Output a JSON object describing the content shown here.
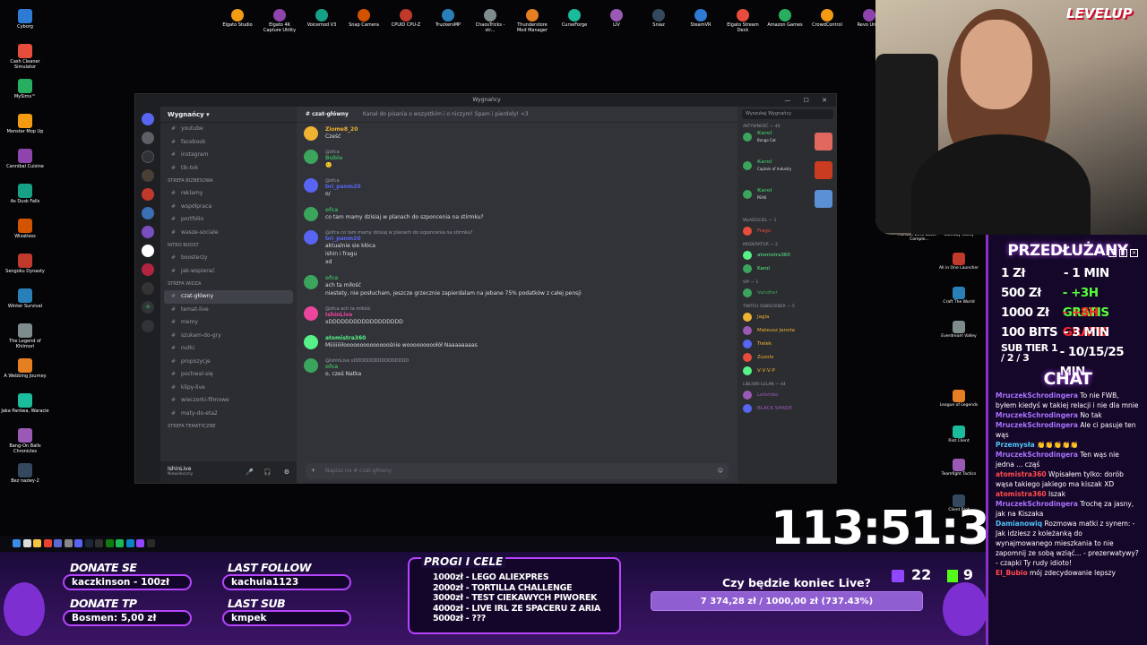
{
  "desktop_left": [
    "Cyborg",
    "Cash Cleaner Simulator",
    "MySims™",
    "Monster Mop Up",
    "Cannibal Cuisine",
    "As Dusk Falls",
    "Wizatless",
    "Sengoku Dynasty",
    "Winter Survival",
    "The Legend of Khiimori",
    "A Webbing Journey",
    "Jaka Parówa, Waracie",
    "Bang-On Balls Chronicles",
    "Bez nazwy-2"
  ],
  "desktop_top": [
    "Elgato Studio",
    "Elgato 4K Capture Utility",
    "Voicemod V3",
    "Snap Camera",
    "CPUID CPU-Z",
    "TruckersMP",
    "ChaosTricks - str...",
    "Thunderstore Mod Manager",
    "CurseForge",
    "LIV",
    "Sniaz",
    "SteamVR",
    "Elgato Stream Deck",
    "Amazon Games",
    "CrowdControl",
    "Revo Uni..."
  ],
  "desktop_right": [
    "Horizon Zero Dawn™ Comple...",
    "Standby Valley",
    "All in One Launcher",
    "Craft The World",
    "Everdream Valley",
    "League of Legends",
    "Riot Client",
    "Teamfight Tactics",
    "Client Riot"
  ],
  "discord": {
    "window_title": "Wygnańcy",
    "server_name": "Wygnańcy",
    "channels_top": [
      "youtube",
      "facebook",
      "instagram",
      "tik-tok"
    ],
    "category_1": "STREFA BIZNESOWA",
    "channels_biz": [
      "reklamy",
      "współpraca",
      "portfolio",
      "wasze-sociale"
    ],
    "category_2": "NITRO BOOST",
    "channels_nitro": [
      "boosterzy",
      "jak-wspierać"
    ],
    "category_3": "STREFA WIDZA",
    "channels_widza": [
      "czat-główny",
      "temat-live",
      "memy",
      "szukam-do-gry",
      "nutki",
      "propozycje",
      "pochwal-się",
      "klipy-live",
      "wieczorki-filmowe",
      "maty-do-eta2"
    ],
    "category_4": "STREFA TEMATYCZNE",
    "new_unread": "NOWE NIEPRZECZYTANE WIAD.",
    "user_name": "IshinLive",
    "user_status": "Niewidoczny",
    "chat_channel": "czat-główny",
    "chat_topic": "Kanał do pisania o wszystkim i o niczym! Spam i pierdoły! <3",
    "input_placeholder": "Napisz na #   czat-główny",
    "search_placeholder": "Wyszukaj Wygnańcy",
    "messages": [
      {
        "name": "Ziome8_20",
        "text": "Cześć",
        "color": "#f0b232"
      },
      {
        "name": "Bubio",
        "reply": "@ofca",
        "text": "🙂",
        "color": "#3ba55d"
      },
      {
        "name": "bri_panm20",
        "reply": "@ofca",
        "text": "o/",
        "color": "#5865f2"
      },
      {
        "name": "ofca",
        "text": "co tam mamy dzisiaj w planach do szponcenia na stirmku?",
        "color": "#3ba55d"
      },
      {
        "name": "bri_panm20",
        "reply": "@ofca co tam mamy dzisiaj w planach do szponcenia na stirmku?",
        "text": "aktualnie sie kłóca",
        "text2": "ishin i fragu",
        "text3": "xd",
        "color": "#5865f2"
      },
      {
        "name": "ofca",
        "text": "ach ta miłość",
        "text2": "niestety, nie posłucham, jeszcze grzecznie zapierdalam na jebane 75% podatków z całej pensji",
        "color": "#3ba55d"
      },
      {
        "name": "IshinLive",
        "reply": "@ofca ach ta miłość",
        "text": "xDDDDDDDDDDDDDDDDDD",
        "color": "#eb459e"
      },
      {
        "name": "atomistra360",
        "text": "Miiiiiiiiłoooooooooooooośnie wooooooooołół Naaaaaaaas",
        "color": "#57f287"
      },
      {
        "name": "ofca",
        "reply": "@IshinLive xDDDDDDDDDDDDDDDD",
        "text": "o, cześ Natka",
        "color": "#3ba55d"
      }
    ],
    "members_header": "Aktywność — 40",
    "members_groups": [
      {
        "label": "WŁAŚCICIEL — 1",
        "members": [
          "Fragu"
        ]
      },
      {
        "label": "Moderator — 2",
        "members": [
          "atomistra360",
          "Karol"
        ]
      },
      {
        "label": "VIP — 1",
        "members": [
          "Vandher"
        ]
      },
      {
        "label": "Twitch Subscriber — 5",
        "members": [
          "Jagla",
          "Mateusz Janota",
          "Trelek",
          "Zuzolo",
          "V·V·V·P"
        ]
      },
      {
        "label": "Liblioki lulan — 44",
        "members": [
          "Lelombo",
          "BLACK SHADE"
        ]
      }
    ],
    "activity_cards": [
      {
        "user": "Karol",
        "app": "Bongo Cat",
        "color": "#e0685e"
      },
      {
        "user": "Karol",
        "app": "Captain of Industry",
        "color": "#c93c1f"
      },
      {
        "user": "Karol",
        "app": "PEAK",
        "color": "#5b8fd6"
      }
    ]
  },
  "taskbar_icons": [
    "windows",
    "search",
    "explorer",
    "chrome",
    "store",
    "settings",
    "discord",
    "steam",
    "obs",
    "xbox",
    "spotify",
    "edge",
    "twitch",
    "epic"
  ],
  "stream": {
    "cam_logo": "LEVELUP",
    "panel_title": "PRZEDŁUŻANY",
    "prices": [
      {
        "k": "1 Zł",
        "v": "- 1 MIN",
        "accent": ""
      },
      {
        "k": "500 Zł",
        "v": "- +3H GRATIS",
        "accent": "green"
      },
      {
        "k": "1000 Zł",
        "v": "- +8H GRATIS",
        "accent": "red"
      },
      {
        "k": "100 BITS",
        "v": "- 3 MIN",
        "accent": ""
      },
      {
        "k": "SUB TIER 1 / 2 / 3",
        "v": "- 10/15/25 MIN",
        "accent": ""
      }
    ],
    "chat_title": "CHAT",
    "chat": [
      {
        "u": "MruczekSchrodingera",
        "t": "To nie FWB, byłem kiedyś w takiej relacji i nie dla mnie",
        "c": "purple"
      },
      {
        "u": "MruczekSchrodingera",
        "t": "No tak",
        "c": "purple"
      },
      {
        "u": "MruczekSchrodingera",
        "t": "Ale ci pasuje ten wąs",
        "c": "purple"
      },
      {
        "u": "Przemysła",
        "t": "👏👏👏👏👏",
        "c": "cyan"
      },
      {
        "u": "MruczekSchrodingera",
        "t": "Ten wąs nie jedna ... cząś",
        "c": "purple"
      },
      {
        "u": "atomistra360",
        "t": "Wpisałem tylko: dorób wąsa takiego jakiego ma kiszak XD",
        "c": "red"
      },
      {
        "u": "atomistra360",
        "t": "Iszak",
        "c": "red"
      },
      {
        "u": "MruczekSchrodingera",
        "t": "Trochę za jasny, jak na Kiszaka",
        "c": "purple"
      },
      {
        "u": "Damianowiq",
        "t": "Rozmowa matki z synem: - Jak idziesz z koleżanką do wynajmowanego mieszkania to nie zapomnij ze sobą wziąć... - prezerwatywy? - czapki Ty rudy idioto!",
        "c": "cyan"
      },
      {
        "u": "El_Bubio",
        "t": "mój zdecydowanie lepszy",
        "c": "red"
      }
    ],
    "timer": "113:51:38",
    "donate_se_label": "DONATE SE",
    "donate_se_value": "kaczkinson - 100zł",
    "donate_tp_label": "DONATE TP",
    "donate_tp_value": "Bosmen: 5,00 zł",
    "last_follow_label": "LAST FOLLOW",
    "last_follow_value": "kachula1123",
    "last_sub_label": "LAST SUB",
    "last_sub_value": "kmpek",
    "goals_title": "PROGI I CELE",
    "goals": [
      "1000zł - LEGO ALIEXPRES",
      "2000zł - TORTILLA CHALLENGE",
      "3000zł - TEST CIEKAWYCH PIWOREK",
      "4000zł - LIVE IRL ZE SPACERU Z ARIA",
      "5000zł - ???"
    ],
    "poll_question": "Czy będzie koniec Live?",
    "poll_value": "7 374,28 zł / 1000,00 zł (737.43%)",
    "poll_fraction": 1.0,
    "twitch_viewers": "22",
    "kick_viewers": "9"
  }
}
